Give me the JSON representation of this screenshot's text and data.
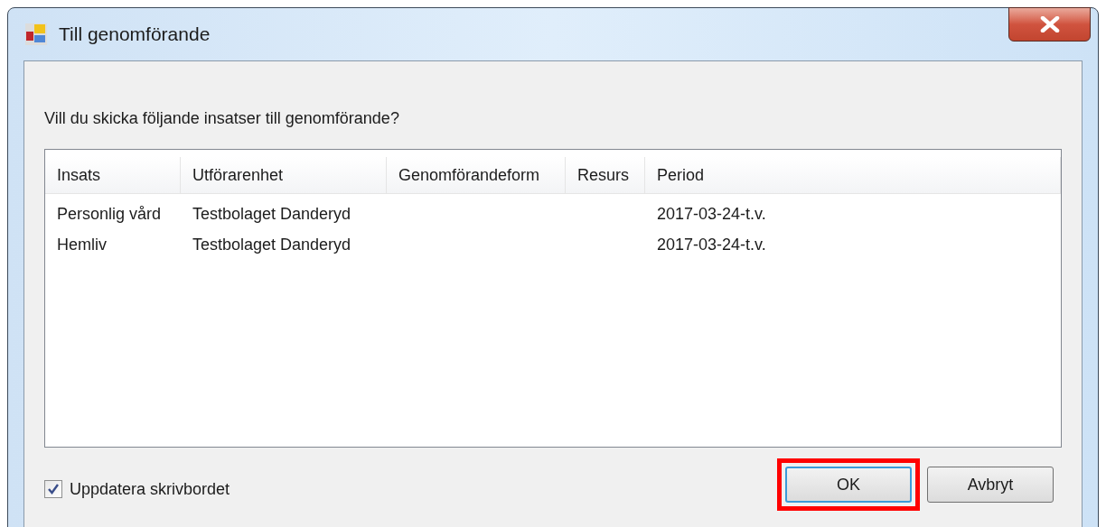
{
  "window": {
    "title": "Till genomförande"
  },
  "prompt": "Vill du skicka följande insatser till genomförande?",
  "table": {
    "columns": [
      "Insats",
      "Utförarenhet",
      "Genomförandeform",
      "Resurs",
      "Period"
    ],
    "rows": [
      [
        "Personlig vård",
        "Testbolaget Danderyd",
        "",
        "",
        "2017-03-24-t.v."
      ],
      [
        "Hemliv",
        "Testbolaget Danderyd",
        "",
        "",
        "2017-03-24-t.v."
      ]
    ]
  },
  "checkbox": {
    "label": "Uppdatera skrivbordet",
    "checked": true
  },
  "buttons": [
    {
      "label": "OK",
      "default": true,
      "highlighted": true
    },
    {
      "label": "Avbryt",
      "default": false,
      "highlighted": false
    }
  ]
}
